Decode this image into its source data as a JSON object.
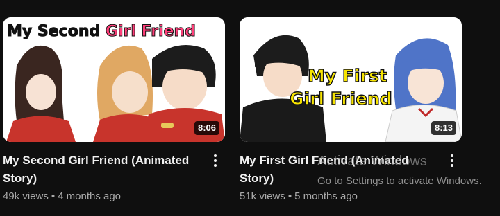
{
  "videos": [
    {
      "thumbnail_text_black": "My Second",
      "thumbnail_text_pink": "Girl Friend",
      "duration": "8:06",
      "title": "My Second Girl Friend (Animated Story)",
      "views": "49k views",
      "age": "4 months ago"
    },
    {
      "thumbnail_text_line1": "My First",
      "thumbnail_text_line2": "Girl Friend",
      "duration": "8:13",
      "title": "My First Girl Friend (Animated Story)",
      "views": "51k views",
      "age": "5 months ago"
    }
  ],
  "separator": "•",
  "watermark": {
    "title": "Activate Windows",
    "subtitle": "Go to Settings to activate Windows."
  },
  "colors": {
    "background": "#0f0f0f",
    "title_text": "#f1f1f1",
    "meta_text": "#aaaaaa",
    "accent_pink": "#ff3f7a",
    "accent_yellow": "#f7e400"
  }
}
